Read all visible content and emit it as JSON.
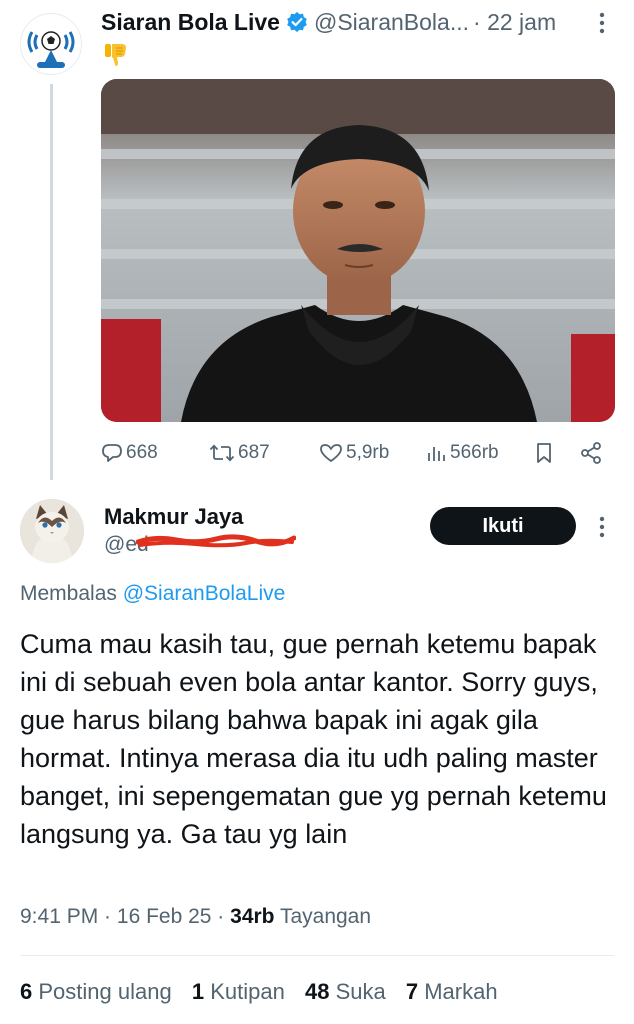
{
  "tweet": {
    "author_name": "Siaran Bola Live",
    "handle": "@SiaranBola...",
    "time": "· 22 jam",
    "emoji": "👎",
    "actions": {
      "replies": "668",
      "reposts": "687",
      "likes": "5,9rb",
      "views": "566rb"
    }
  },
  "reply": {
    "author_name": "Makmur Jaya",
    "handle": "@ed",
    "follow_label": "Ikuti",
    "replying_prefix": "Membalas",
    "replying_to": "@SiaranBolaLive",
    "text": "Cuma mau kasih tau, gue pernah ketemu bapak ini di sebuah even bola antar kantor. Sorry guys, gue harus bilang bahwa bapak ini agak gila hormat. Intinya merasa dia itu udh paling master banget, ini sepengematan gue yg pernah ketemu langsung ya. Ga tau yg lain",
    "time": "9:41 PM",
    "date": "16 Feb 25",
    "views_count": "34rb",
    "views_label": "Tayangan",
    "stats": {
      "reposts_count": "6",
      "reposts_label": "Posting ulang",
      "quotes_count": "1",
      "quotes_label": "Kutipan",
      "likes_count": "48",
      "likes_label": "Suka",
      "bookmarks_count": "7",
      "bookmarks_label": "Markah"
    }
  },
  "colors": {
    "text": "#0f1419",
    "secondary": "#536471",
    "link": "#1d9bf0",
    "verified": "#1d9bf0",
    "button_bg": "#0f1419",
    "scribble": "#e0301e"
  },
  "icons": {
    "verified": "verified-badge-icon",
    "more": "more-vertical-icon",
    "reply": "reply-bubble-icon",
    "repost": "repost-arrows-icon",
    "like": "heart-icon",
    "views": "views-bars-icon",
    "bookmark": "bookmark-icon",
    "share": "share-icon"
  }
}
